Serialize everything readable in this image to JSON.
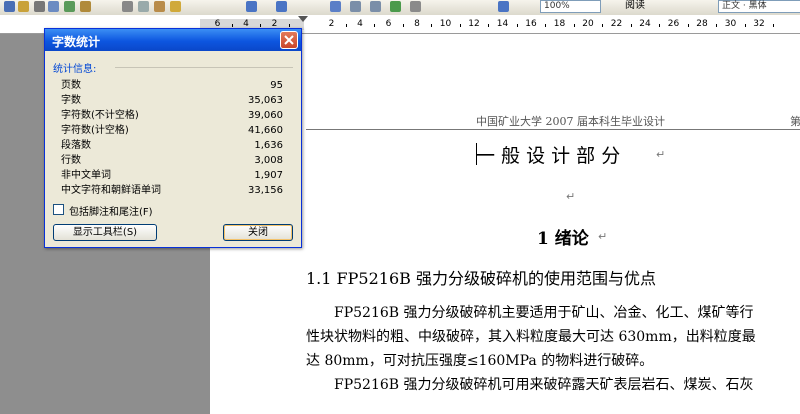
{
  "toolbar": {
    "zoom_value": "100%",
    "reading_label": "阅读",
    "style_value": "正文 · 黑体"
  },
  "ruler": {
    "numbers": [
      "6",
      "4",
      "2",
      "2",
      "4",
      "6",
      "8",
      "10",
      "12",
      "14",
      "16",
      "18",
      "20",
      "22",
      "24",
      "26",
      "28",
      "30",
      "32"
    ]
  },
  "document": {
    "header_text": "中国矿业大学 2007 届本科生毕业设计",
    "header_page_partial": "第",
    "part_title": "一 般 设 计 部 分",
    "chapter_title": "1  绪论",
    "section_title": "1.1 FP5216B 强力分级破碎机的使用范围与优点",
    "body_lines": [
      "FP5216B 强力分级破碎机主要适用于矿山、冶金、化工、煤矿等行",
      "性块状物料的粗、中级破碎，其入料粒度最大可达 630mm，出料粒度最",
      "达 80mm，可对抗压强度≤160MPa 的物料进行破碎。",
      "FP5216B 强力分级破碎机可用来破碎露天矿表层岩石、煤炭、石灰"
    ]
  },
  "dialog": {
    "title": "字数统计",
    "group_label": "统计信息:",
    "stats": [
      {
        "label": "页数",
        "value": "95"
      },
      {
        "label": "字数",
        "value": "35,063"
      },
      {
        "label": "字符数(不计空格)",
        "value": "39,060"
      },
      {
        "label": "字符数(计空格)",
        "value": "41,660"
      },
      {
        "label": "段落数",
        "value": "1,636"
      },
      {
        "label": "行数",
        "value": "3,008"
      },
      {
        "label": "非中文单词",
        "value": "1,907"
      },
      {
        "label": "中文字符和朝鲜语单词",
        "value": "33,156"
      }
    ],
    "checkbox_label": "包括脚注和尾注(F)",
    "checkbox_checked": false,
    "show_toolbar_button": "显示工具栏(S)",
    "close_button": "关闭"
  },
  "colors": {
    "titlebar_blue": "#0d56e0",
    "close_red": "#c9462a",
    "dialog_bg": "#ece9d8",
    "group_label_blue": "#0046d5"
  }
}
